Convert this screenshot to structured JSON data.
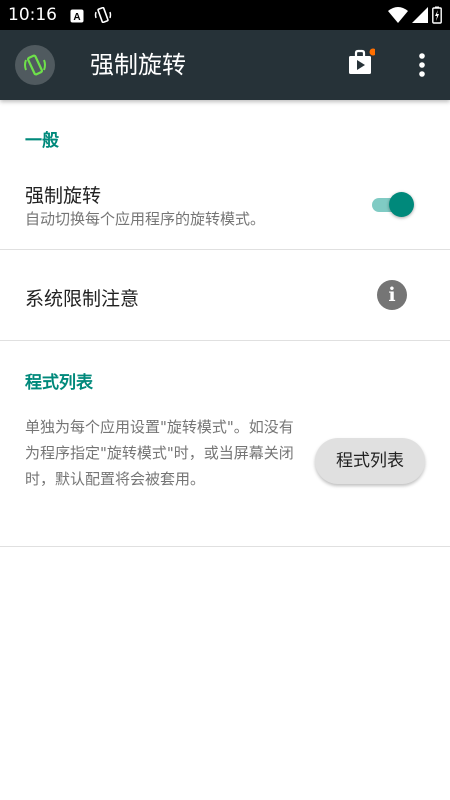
{
  "status_bar": {
    "time": "10:16"
  },
  "app_bar": {
    "title": "强制旋转"
  },
  "sections": {
    "general": {
      "header": "一般",
      "force_rotation": {
        "title": "强制旋转",
        "subtitle": "自动切换每个应用程序的旋转模式。",
        "enabled": true
      },
      "system_limit": {
        "title": "系统限制注意",
        "info_glyph": "i"
      }
    },
    "app_list": {
      "header": "程式列表",
      "description": "单独为每个应用设置\"旋转模式\"。如没有为程序指定\"旋转模式\"时，或当屏幕关闭时，默认配置将会被套用。",
      "button_label": "程式列表"
    }
  },
  "colors": {
    "accent": "#00897b",
    "app_bar": "#263238",
    "notification_dot": "#ff6f00"
  },
  "icons": [
    "rotation-icon",
    "a-icon",
    "wifi-icon",
    "signal-icon",
    "battery-charging-icon",
    "store-icon",
    "more-vert-icon",
    "info-icon"
  ]
}
